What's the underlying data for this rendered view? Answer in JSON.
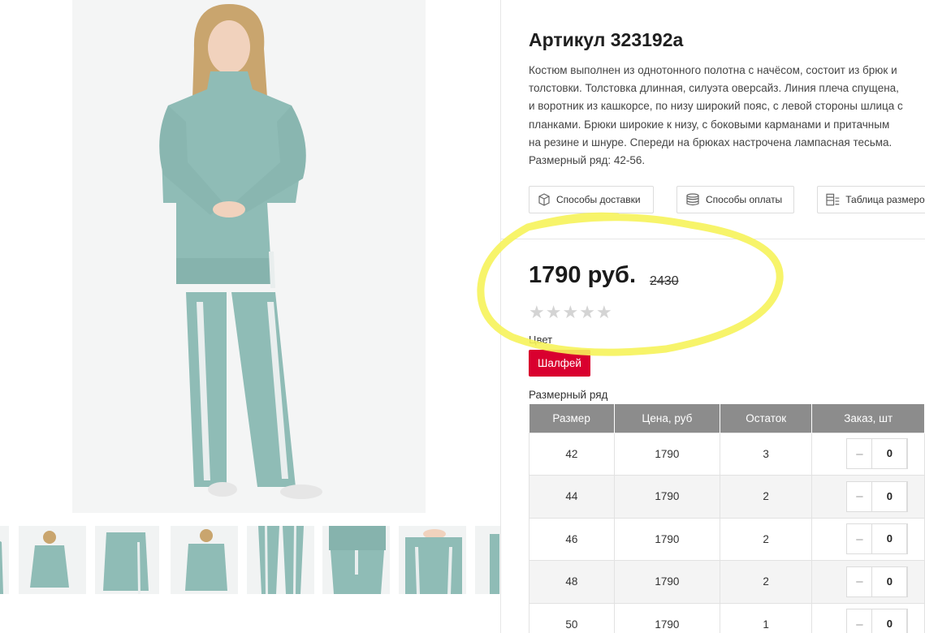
{
  "product": {
    "title": "Артикул 323192а",
    "description": [
      "Костюм выполнен из однотонного полотна с начёсом, состоит из брюк и",
      "толстовки. Толстовка длинная, силуэта оверсайз. Линия плеча спущена,",
      "и воротник из кашкорсе, по низу широкий пояс, с левой стороны шлица с",
      "планками. Брюки широкие к низу, с боковыми карманами и притачным",
      "на резине и шнуре. Спереди на брюках настрочена лампасная тесьма.",
      "Размерный ряд: 42-56."
    ],
    "price": "1790 руб.",
    "old_price": "2430",
    "rating": 0,
    "rating_max": 5
  },
  "info_buttons": {
    "delivery": "Способы доставки",
    "payment": "Способы оплаты",
    "sizes": "Таблица размеров"
  },
  "color": {
    "label": "Цвет",
    "selected": "Шалфей",
    "accent": "#d9002f"
  },
  "size_table": {
    "label": "Размерный ряд",
    "headers": [
      "Размер",
      "Цена, руб",
      "Остаток",
      "Заказ, шт"
    ],
    "rows": [
      {
        "size": "42",
        "price": "1790",
        "stock": "3",
        "qty": "0"
      },
      {
        "size": "44",
        "price": "1790",
        "stock": "2",
        "qty": "0"
      },
      {
        "size": "46",
        "price": "1790",
        "stock": "2",
        "qty": "0"
      },
      {
        "size": "48",
        "price": "1790",
        "stock": "2",
        "qty": "0"
      },
      {
        "size": "50",
        "price": "1790",
        "stock": "1",
        "qty": "0"
      }
    ],
    "minus_glyph": "–"
  },
  "colors": {
    "garment": "#8fbcb6",
    "highlight": "#f6f35a",
    "header_gray": "#8c8c8c"
  }
}
